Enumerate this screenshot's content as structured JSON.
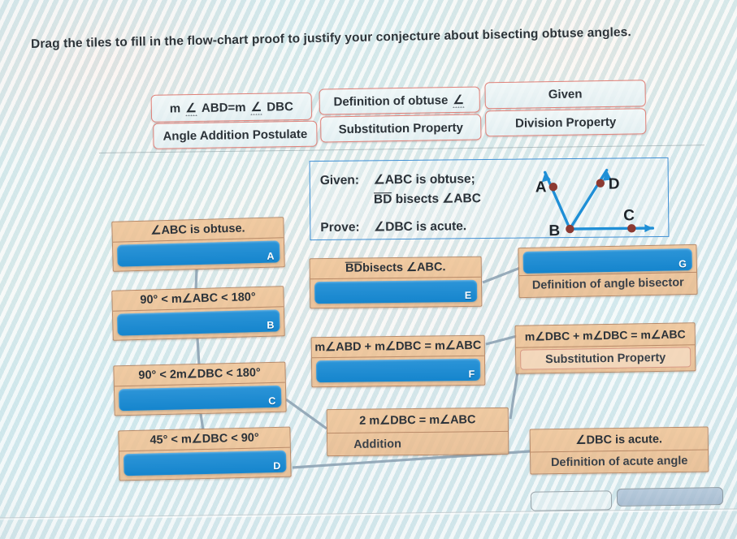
{
  "instruction": "Drag the tiles to fill in the flow-chart proof to justify your conjecture about bisecting obtuse angles.",
  "colors": {
    "tile_border": "#e0827a",
    "box_fill": "#f0c496",
    "box_border": "#b98a68",
    "slot_blue": "#1f8fd6",
    "given_border": "#3f8fd4",
    "figure_line": "#1f8fd6",
    "figure_point": "#8c3a32"
  },
  "tile_bank": {
    "tiles": [
      {
        "id": "tile-1",
        "label": "m ∠ ABD=m ∠ DBC"
      },
      {
        "id": "tile-2",
        "label": "Definition of obtuse ∠"
      },
      {
        "id": "tile-3",
        "label": "Given"
      },
      {
        "id": "tile-4",
        "label": "Angle Addition Postulate"
      },
      {
        "id": "tile-5",
        "label": "Substitution Property"
      },
      {
        "id": "tile-6",
        "label": "Division Property"
      }
    ]
  },
  "given_panel": {
    "given_label": "Given:",
    "given_line_1": "∠ABC is obtuse;",
    "given_line_2_overline": "BD",
    "given_line_2_rest": " bisects ∠ABC",
    "prove_label": "Prove:",
    "prove_text": "∠DBC is acute.",
    "figure": {
      "points": [
        "A",
        "B",
        "C",
        "D"
      ],
      "rays": [
        "BA",
        "BD",
        "BC"
      ],
      "vertex": "B"
    }
  },
  "flowchart": {
    "boxes": [
      {
        "id": "A",
        "statement": "∠ABC is obtuse.",
        "reason": "",
        "slot_tag": "A",
        "slot_filled": false,
        "slot_position": "below"
      },
      {
        "id": "B",
        "statement": "90° < m∠ABC < 180°",
        "reason": "",
        "slot_tag": "B",
        "slot_filled": false,
        "slot_position": "below"
      },
      {
        "id": "C",
        "statement": "90° < 2m∠DBC < 180°",
        "reason": "",
        "slot_tag": "C",
        "slot_filled": false,
        "slot_position": "below"
      },
      {
        "id": "D",
        "statement": "45° < m∠DBC < 90°",
        "reason": "",
        "slot_tag": "D",
        "slot_filled": false,
        "slot_position": "below"
      },
      {
        "id": "E",
        "statement_overline": "BD",
        "statement_rest": " bisects ∠ABC.",
        "reason": "",
        "slot_tag": "E",
        "slot_filled": false,
        "slot_position": "below"
      },
      {
        "id": "F",
        "statement": "m∠ABD + m∠DBC = m∠ABC",
        "reason": "",
        "slot_tag": "F",
        "slot_filled": false,
        "slot_position": "below"
      },
      {
        "id": "G",
        "statement": "",
        "reason": "Definition of angle bisector",
        "slot_tag": "G",
        "slot_filled": false,
        "slot_position": "above"
      },
      {
        "id": "sub",
        "statement": "m∠DBC + m∠DBC = m∠ABC",
        "reason": "Substitution Property",
        "slot_filled": true
      },
      {
        "id": "add",
        "statement": "2 m∠DBC = m∠ABC",
        "reason": "Addition",
        "slot_filled": true
      },
      {
        "id": "acute",
        "statement": "∠DBC is acute.",
        "reason": "Definition of acute angle",
        "slot_filled": true
      }
    ]
  },
  "footer": {
    "button_left_label": "",
    "button_right_label": ""
  }
}
